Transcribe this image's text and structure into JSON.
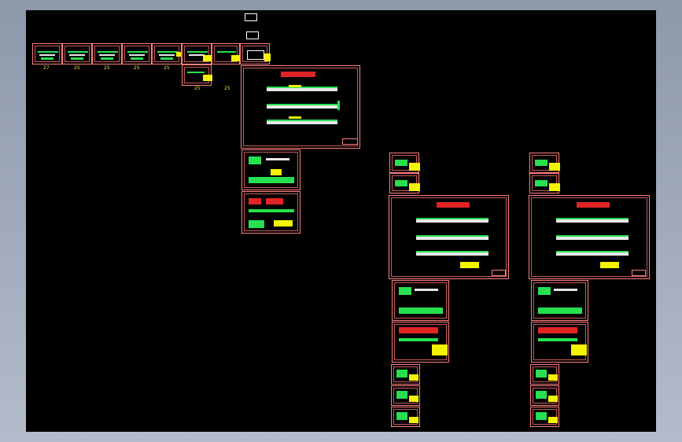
{
  "strip_labels": [
    "27",
    "25",
    "25",
    "25",
    "25",
    "25",
    "25"
  ],
  "colors": {
    "background": "#000000",
    "frame": "#ff7f7f",
    "geometry": "#27e050",
    "annotation": "#f4f400",
    "accent": "#e02424"
  }
}
